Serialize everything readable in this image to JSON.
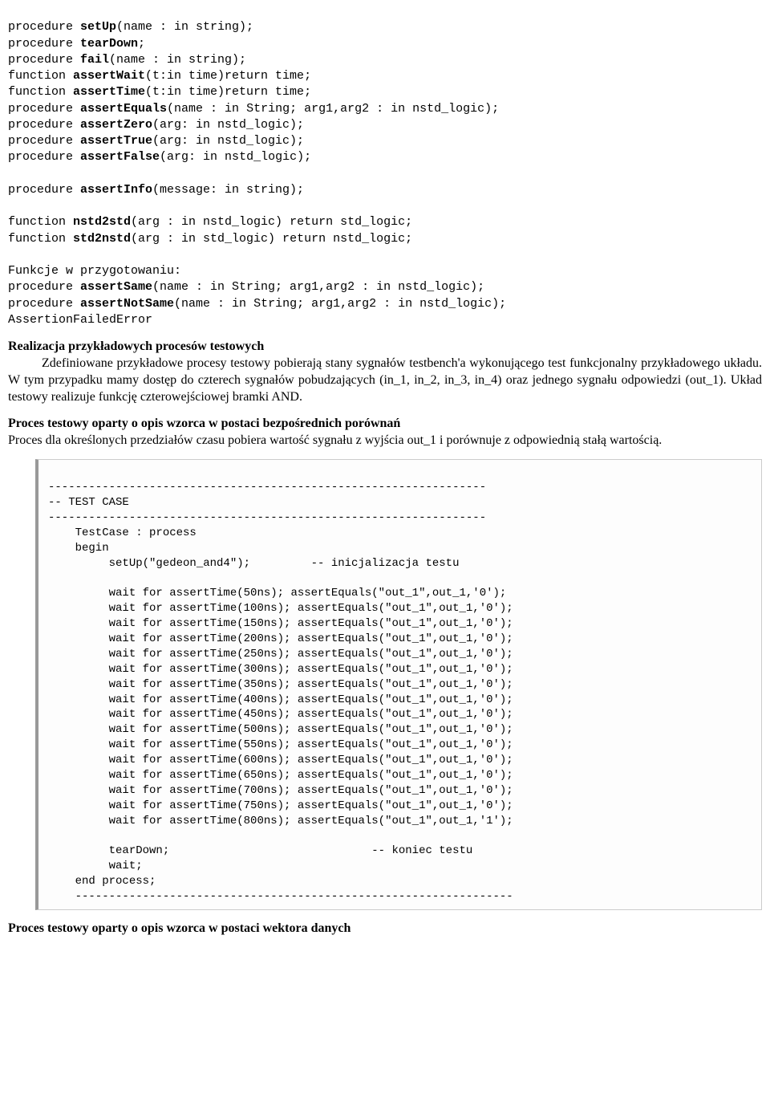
{
  "code1": {
    "l1a": "procedure ",
    "l1b": "setUp",
    "l1c": "(name : in string);",
    "l2a": "procedure ",
    "l2b": "tearDown",
    "l2c": ";",
    "l3a": "procedure ",
    "l3b": "fail",
    "l3c": "(name : in string);",
    "l4a": "function ",
    "l4b": "assertWait",
    "l4c": "(t:in time)return time;",
    "l5a": "function ",
    "l5b": "assertTime",
    "l5c": "(t:in time)return time;",
    "l6a": "procedure ",
    "l6b": "assertEquals",
    "l6c": "(name : in String; arg1,arg2 : in nstd_logic);",
    "l7a": "procedure ",
    "l7b": "assertZero",
    "l7c": "(arg: in nstd_logic);",
    "l8a": "procedure ",
    "l8b": "assertTrue",
    "l8c": "(arg: in nstd_logic);",
    "l9a": "procedure ",
    "l9b": "assertFalse",
    "l9c": "(arg: in nstd_logic);",
    "l10": "",
    "l11a": "procedure ",
    "l11b": "assertInfo",
    "l11c": "(message: in string);",
    "l12": "",
    "l13a": "function ",
    "l13b": "nstd2std",
    "l13c": "(arg : in nstd_logic) return std_logic;",
    "l14a": "function ",
    "l14b": "std2nstd",
    "l14c": "(arg : in std_logic) return nstd_logic;",
    "l15": "",
    "l16": "Funkcje w przygotowaniu:",
    "l17a": "procedure ",
    "l17b": "assertSame",
    "l17c": "(name : in String; arg1,arg2 : in nstd_logic);",
    "l18a": "procedure ",
    "l18b": "assertNotSame",
    "l18c": "(name : in String; arg1,arg2 : in nstd_logic);",
    "l19": "AssertionFailedError"
  },
  "h1": "Realizacja przykładowych procesów testowych",
  "p1": "Zdefiniowane przykładowe procesy testowy pobierają stany sygnałów testbench'a wykonującego test funkcjonalny przykładowego układu. W tym przypadku mamy dostęp do czterech sygnałów pobudzających (in_1, in_2, in_3, in_4) oraz jednego sygnału odpowiedzi (out_1). Układ testowy realizuje funkcję czterowejściowej bramki AND.",
  "h2": "Proces testowy oparty o opis wzorca w postaci bezpośrednich porównań",
  "p2": "Proces dla określonych przedziałów czasu pobiera wartość sygnału z wyjścia out_1 i porównuje z odpowiednią stałą wartością.",
  "code2": {
    "r1": "-----------------------------------------------------------------",
    "r2": "-- TEST CASE",
    "r3": "-----------------------------------------------------------------",
    "r4": "    TestCase : process",
    "r5": "    begin",
    "r6": "         setUp(\"gedeon_and4\");         -- inicjalizacja testu",
    "r7": "",
    "r8": "         wait for assertTime(50ns); assertEquals(\"out_1\",out_1,'0');",
    "r9": "         wait for assertTime(100ns); assertEquals(\"out_1\",out_1,'0');",
    "r10": "         wait for assertTime(150ns); assertEquals(\"out_1\",out_1,'0');",
    "r11": "         wait for assertTime(200ns); assertEquals(\"out_1\",out_1,'0');",
    "r12": "         wait for assertTime(250ns); assertEquals(\"out_1\",out_1,'0');",
    "r13": "         wait for assertTime(300ns); assertEquals(\"out_1\",out_1,'0');",
    "r14": "         wait for assertTime(350ns); assertEquals(\"out_1\",out_1,'0');",
    "r15": "         wait for assertTime(400ns); assertEquals(\"out_1\",out_1,'0');",
    "r16": "         wait for assertTime(450ns); assertEquals(\"out_1\",out_1,'0');",
    "r17": "         wait for assertTime(500ns); assertEquals(\"out_1\",out_1,'0');",
    "r18": "         wait for assertTime(550ns); assertEquals(\"out_1\",out_1,'0');",
    "r19": "         wait for assertTime(600ns); assertEquals(\"out_1\",out_1,'0');",
    "r20": "         wait for assertTime(650ns); assertEquals(\"out_1\",out_1,'0');",
    "r21": "         wait for assertTime(700ns); assertEquals(\"out_1\",out_1,'0');",
    "r22": "         wait for assertTime(750ns); assertEquals(\"out_1\",out_1,'0');",
    "r23": "         wait for assertTime(800ns); assertEquals(\"out_1\",out_1,'1');",
    "r24": "",
    "r25": "         tearDown;                              -- koniec testu",
    "r26": "         wait;",
    "r27": "    end process;",
    "r28": "    -----------------------------------------------------------------"
  },
  "h3": "Proces testowy oparty o opis wzorca w postaci wektora danych"
}
